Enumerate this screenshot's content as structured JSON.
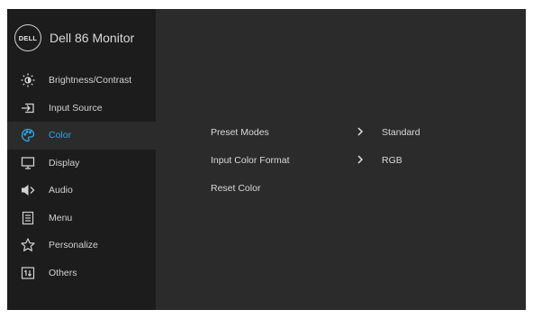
{
  "header": {
    "logo_text": "DELL",
    "title": "Dell 86 Monitor"
  },
  "sidebar": {
    "items": [
      {
        "label": "Brightness/Contrast",
        "icon": "brightness-icon"
      },
      {
        "label": "Input Source",
        "icon": "input-source-icon"
      },
      {
        "label": "Color",
        "icon": "color-palette-icon",
        "active": true
      },
      {
        "label": "Display",
        "icon": "display-icon"
      },
      {
        "label": "Audio",
        "icon": "speaker-icon"
      },
      {
        "label": "Menu",
        "icon": "menu-list-icon"
      },
      {
        "label": "Personalize",
        "icon": "star-icon"
      },
      {
        "label": "Others",
        "icon": "others-icon"
      }
    ]
  },
  "color_menu": {
    "rows": [
      {
        "label": "Preset Modes",
        "value": "Standard",
        "has_submenu": true
      },
      {
        "label": "Input Color Format",
        "value": "RGB",
        "has_submenu": true
      },
      {
        "label": "Reset Color",
        "value": "",
        "has_submenu": false
      }
    ]
  },
  "colors": {
    "accent": "#2da8e8",
    "sidebar_bg": "#1c1c1c",
    "panel_bg": "#2b2b2b"
  }
}
